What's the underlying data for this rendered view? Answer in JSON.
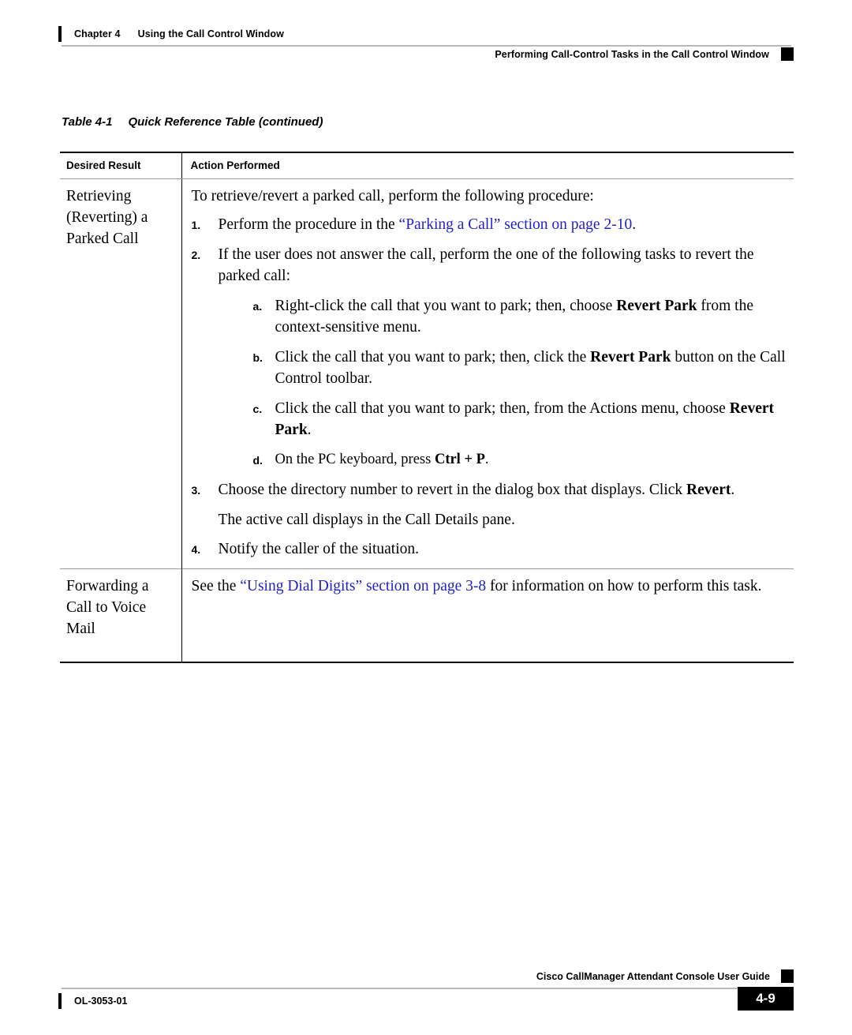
{
  "header": {
    "chapter_label": "Chapter 4",
    "chapter_title": "Using the Call Control Window",
    "section_title": "Performing Call-Control Tasks in the Call Control Window"
  },
  "table_caption": {
    "number": "Table 4-1",
    "title": "Quick Reference Table (continued)"
  },
  "table": {
    "headers": {
      "col1": "Desired Result",
      "col2": "Action Performed"
    },
    "rows": [
      {
        "desired_result": "Retrieving (Reverting) a Parked Call",
        "desired_result_lines": [
          "Retrieving",
          "(Reverting) a",
          "Parked Call"
        ],
        "intro": "To retrieve/revert a parked call, perform the following procedure:",
        "steps": [
          {
            "marker": "1.",
            "text_before": "Perform the procedure in the ",
            "link": "“Parking a Call” section on page 2-10",
            "text_after": "."
          },
          {
            "marker": "2.",
            "text": "If the user does not answer the call, perform the one of the following tasks to revert the parked call:",
            "substeps": [
              {
                "marker": "a.",
                "part1": "Right-click the call that you want to park; then, choose ",
                "bold": "Revert Park",
                "part2": " from the context-sensitive menu."
              },
              {
                "marker": "b.",
                "part1": "Click the call that you want to park; then, click the ",
                "bold": "Revert Park",
                "part2": " button on the Call Control toolbar."
              },
              {
                "marker": "c.",
                "part1": "Click the call that you want to park; then, from the Actions menu, choose ",
                "bold": "Revert Park",
                "part2": "."
              },
              {
                "marker": "d.",
                "part1": "On the PC keyboard, press ",
                "bold": "Ctrl + P",
                "part2": "."
              }
            ]
          },
          {
            "marker": "3.",
            "part1": "Choose the directory number to revert in the dialog box that displays. Click ",
            "bold": "Revert",
            "part2": ".",
            "followup": "The active call displays in the Call Details pane."
          },
          {
            "marker": "4.",
            "text": "Notify the caller of the situation."
          }
        ]
      },
      {
        "desired_result": "Forwarding a Call to Voice Mail",
        "desired_result_lines": [
          "Forwarding a",
          "Call to Voice",
          "Mail"
        ],
        "text_before": "See the ",
        "link": "“Using Dial Digits” section on page 3-8",
        "text_after": " for information on how to perform this task."
      }
    ]
  },
  "footer": {
    "guide_title": "Cisco CallManager Attendant Console User Guide",
    "doc_id": "OL-3053-01",
    "page_number": "4-9"
  },
  "colors": {
    "link": "#2222cc",
    "rule": "#b9b9b9",
    "text": "#000000"
  }
}
